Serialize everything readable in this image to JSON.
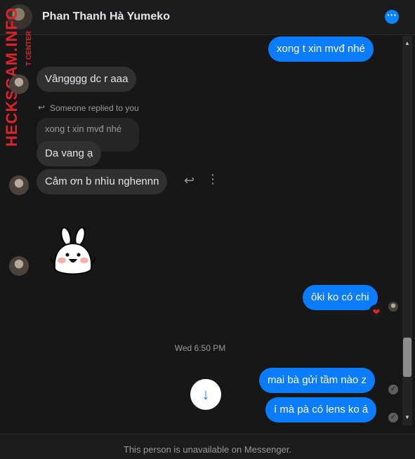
{
  "header": {
    "title": "Phan Thanh Hà Yumeko",
    "more_icon": "more-dots-icon"
  },
  "watermark": {
    "text": "HECKSCAM.INFO",
    "subtext": "T CENTER"
  },
  "messages": [
    {
      "from": "me",
      "text": "xong t xin mvđ nhé"
    },
    {
      "from": "them",
      "text": "Vângggg dc r aaa"
    },
    {
      "from": "them",
      "reply_label": "Someone replied to you",
      "quoted": "xong t xin mvđ nhé",
      "text": "Da vang ạ"
    },
    {
      "from": "them",
      "text": "Cảm ơn b nhìu nghennn"
    },
    {
      "from": "them",
      "sticker": "bunny-sticker"
    },
    {
      "from": "me",
      "text": "ôki ko có chi",
      "reaction": "heart"
    },
    {
      "from": "me",
      "text": "mai bà gửi tầm nào z"
    },
    {
      "from": "me",
      "text": "í mà pà có lens ko á"
    }
  ],
  "timestamp": "Wed 6:50 PM",
  "footer": {
    "notice": "This person is unavailable on Messenger."
  },
  "colors": {
    "accent": "#0a7cff",
    "background": "#171717",
    "incoming_bubble": "#303030",
    "watermark": "#e0232a"
  }
}
